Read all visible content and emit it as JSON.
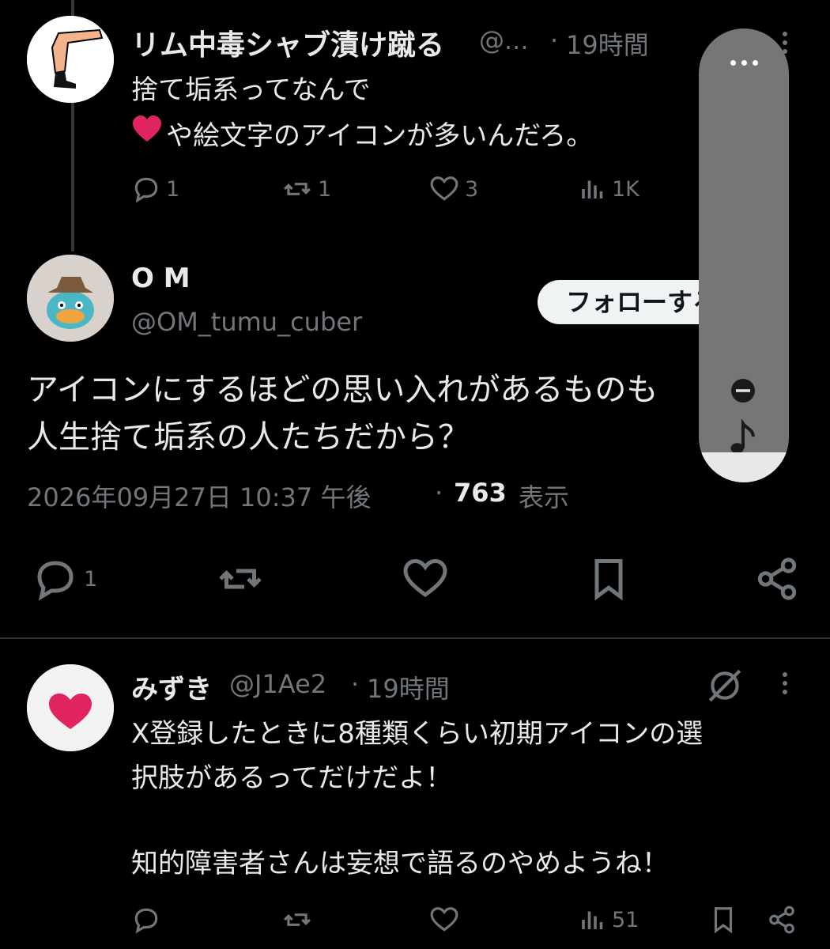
{
  "tweet1": {
    "display_name": "リム中毒シャブ漬け蹴る",
    "handle": "@...",
    "separator": "·",
    "time": "19時間",
    "text_line1": "捨て垢系ってなんで",
    "text_emoji": "❤️",
    "text_line2": "や絵文字のアイコンが多いんだろ。",
    "actions": {
      "replies": "1",
      "reposts": "1",
      "likes": "3",
      "views": "1K"
    }
  },
  "main_tweet": {
    "display_name": "O M",
    "handle": "@OM_tumu_cuber",
    "follow_label": "フォローする",
    "text_line1": "アイコンにするほどの思い入れがあるものも",
    "text_line2": "人生捨て垢系の人たちだから？",
    "timestamp": "2026年09月27日 10:37 午後",
    "separator": "·",
    "views_count": "763",
    "views_label": "表示",
    "actions": {
      "replies": "1"
    }
  },
  "tweet3": {
    "display_name": "みずき",
    "handle": "@J1Ae2",
    "separator": "·",
    "time": "19時間",
    "text_line1": "X登録したときに8種類くらい初期アイコンの選",
    "text_line2": "択肢があるってだけだよ！",
    "text_line3": "知的障害者さんは妄想で語るのやめようね！",
    "actions": {
      "views": "51"
    }
  },
  "colors": {
    "background": "#000000",
    "text_primary": "#e7e9ea",
    "text_muted": "#71767b",
    "divider": "#2f3336",
    "follow_button_bg": "#eff3f4",
    "heart_red": "#e0245e",
    "floating_panel": "#767676"
  },
  "icons": [
    "reply-icon",
    "repost-icon",
    "like-icon",
    "views-icon",
    "bookmark-icon",
    "share-icon",
    "more-icon",
    "grok-icon",
    "minus-circle-icon",
    "music-note-icon"
  ]
}
